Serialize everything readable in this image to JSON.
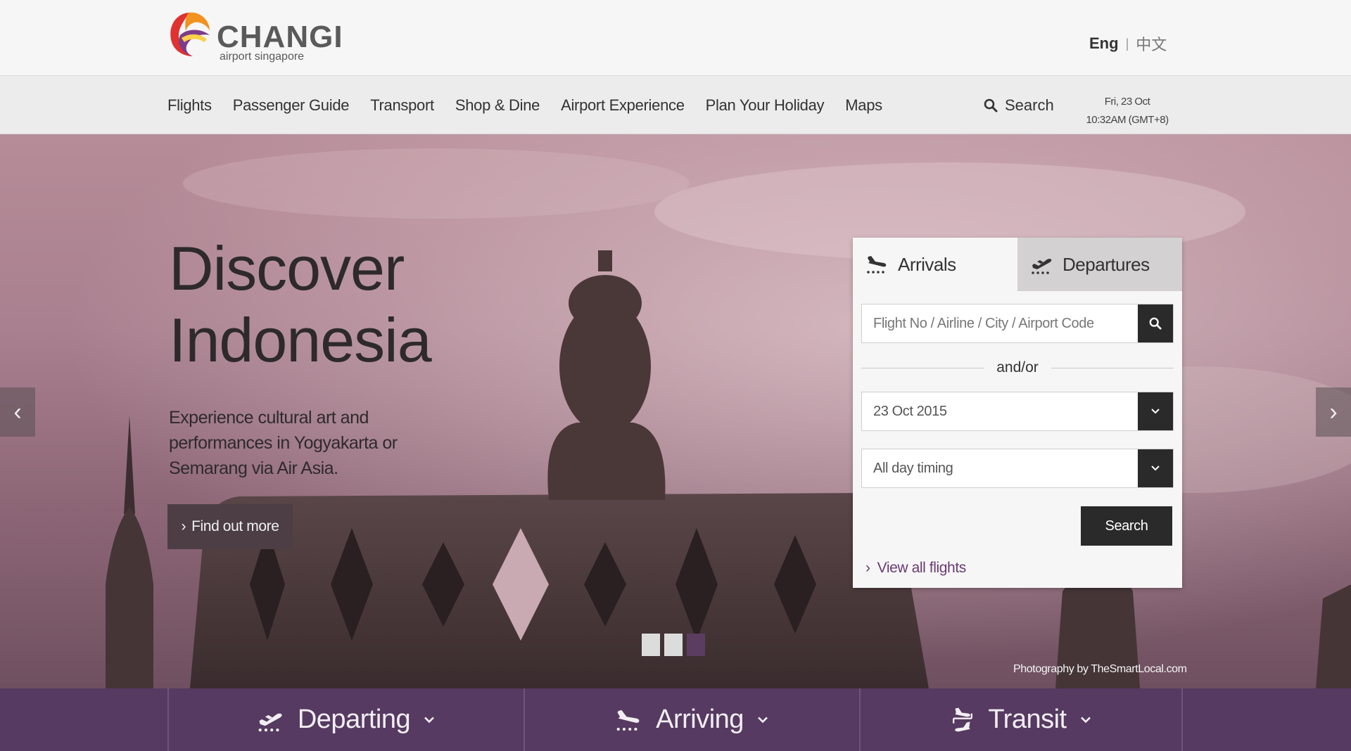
{
  "header": {
    "logo_name": "CHANGI",
    "logo_sub": "airport singapore",
    "lang_active": "Eng",
    "lang_separator": "|",
    "lang_other": "中文"
  },
  "nav": {
    "items": [
      "Flights",
      "Passenger Guide",
      "Transport",
      "Shop & Dine",
      "Airport Experience",
      "Plan Your Holiday",
      "Maps"
    ],
    "search_label": "Search",
    "date": "Fri, 23 Oct",
    "time": "10:32AM (GMT+8)"
  },
  "hero": {
    "title_line1": "Discover",
    "title_line2": "Indonesia",
    "description": "Experience cultural art and performances in Yogyakarta or Semarang via Air Asia.",
    "cta": "Find out more",
    "credit": "Photography by TheSmartLocal.com",
    "slide_count": 3,
    "active_slide": 3
  },
  "widget": {
    "tab_arrivals": "Arrivals",
    "tab_departures": "Departures",
    "flight_placeholder": "Flight No / Airline / City / Airport Code",
    "andor": "and/or",
    "date_value": "23 Oct 2015",
    "timing_value": "All day timing",
    "search_button": "Search",
    "view_all": "View all flights"
  },
  "bottom": {
    "departing": "Departing",
    "arriving": "Arriving",
    "transit": "Transit"
  },
  "colors": {
    "brand_purple": "#563a61",
    "link_purple": "#6a3b73",
    "dark_button": "#2a2a2a"
  }
}
